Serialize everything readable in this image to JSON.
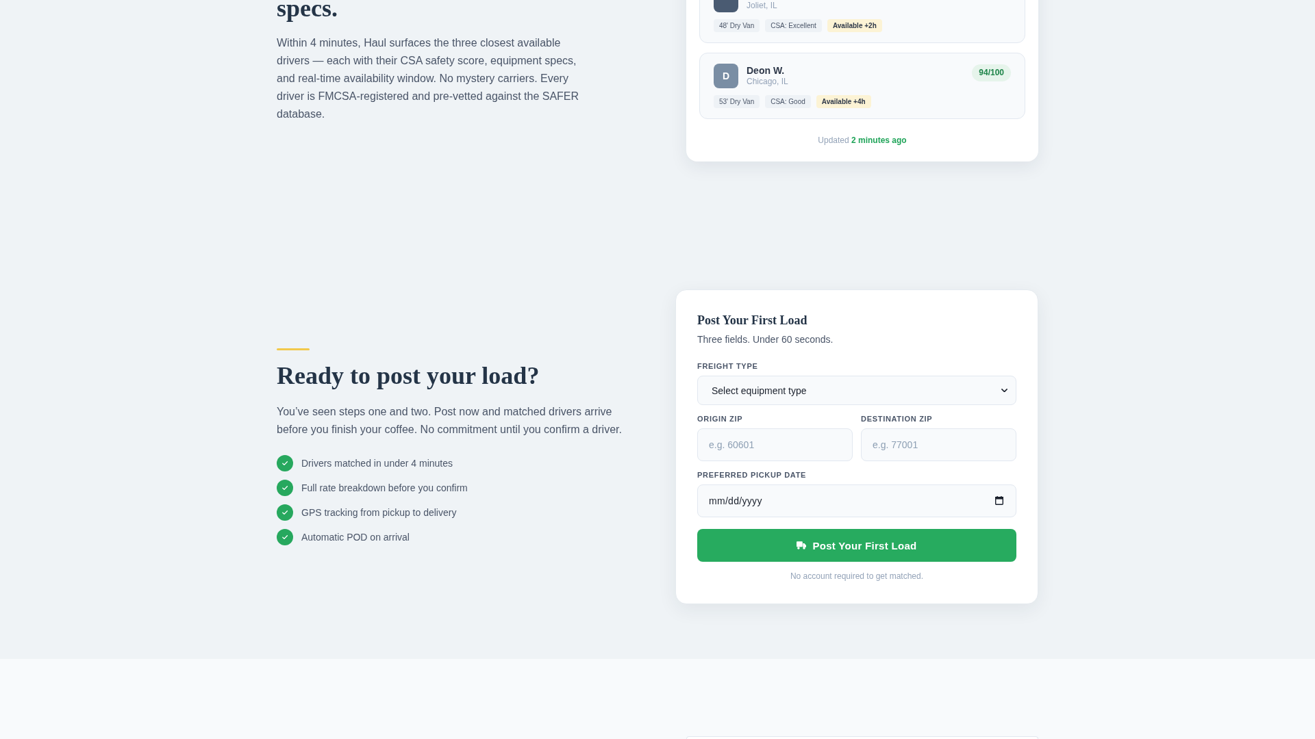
{
  "drivers_section": {
    "heading": "specs.",
    "description": "Within 4 minutes, Haul surfaces the three closest available drivers — each with their CSA safety score, equipment specs, and real-time availability window. No mystery carriers. Every driver is FMCSA-registered and pre-vetted against the SAFER database.",
    "match_card": {
      "drivers": [
        {
          "location": "Joliet, IL",
          "color": "#4a5b72",
          "tags": [
            {
              "kind": "spec",
              "text": "48' Dry Van"
            },
            {
              "kind": "spec",
              "text": "CSA: Excellent"
            },
            {
              "kind": "availability",
              "text": "Available +2h"
            }
          ]
        },
        {
          "initial": "D",
          "name": "Deon W.",
          "location": "Chicago, IL",
          "color": "#7a8ea4",
          "score": "94/100",
          "tags": [
            {
              "kind": "spec",
              "text": "53' Dry Van"
            },
            {
              "kind": "spec",
              "text": "CSA: Good"
            },
            {
              "kind": "availability",
              "text": "Available +4h"
            }
          ]
        }
      ],
      "updated": "Updated **2 minutes ago**"
    }
  },
  "cta_section": {
    "heading": "Ready to post your load?",
    "description": "You’ve seen steps one and two. Post now and matched drivers arrive before you finish your coffee. No commitment until you confirm a driver.",
    "benefits": [
      "Drivers matched in under 4 minutes",
      "Full rate breakdown before you confirm",
      "GPS tracking from pickup to delivery",
      "Automatic POD on arrival"
    ],
    "form": {
      "title": "Post Your First Load",
      "subtitle": "Three fields. Under 60 seconds.",
      "fields": [
        {
          "kind": "select",
          "label": "FREIGHT TYPE",
          "value": "Select equipment type"
        },
        {
          "kind": "text",
          "label": "ORIGIN ZIP",
          "placeholder": "e.g. 60601"
        },
        {
          "kind": "text",
          "label": "DESTINATION ZIP",
          "placeholder": "e.g. 77001"
        },
        {
          "kind": "date",
          "label": "PREFERRED PICKUP DATE",
          "placeholder": "mm/dd/yyyy"
        }
      ],
      "submit": "Post Your First Load",
      "note": "No account required to get matched."
    }
  }
}
